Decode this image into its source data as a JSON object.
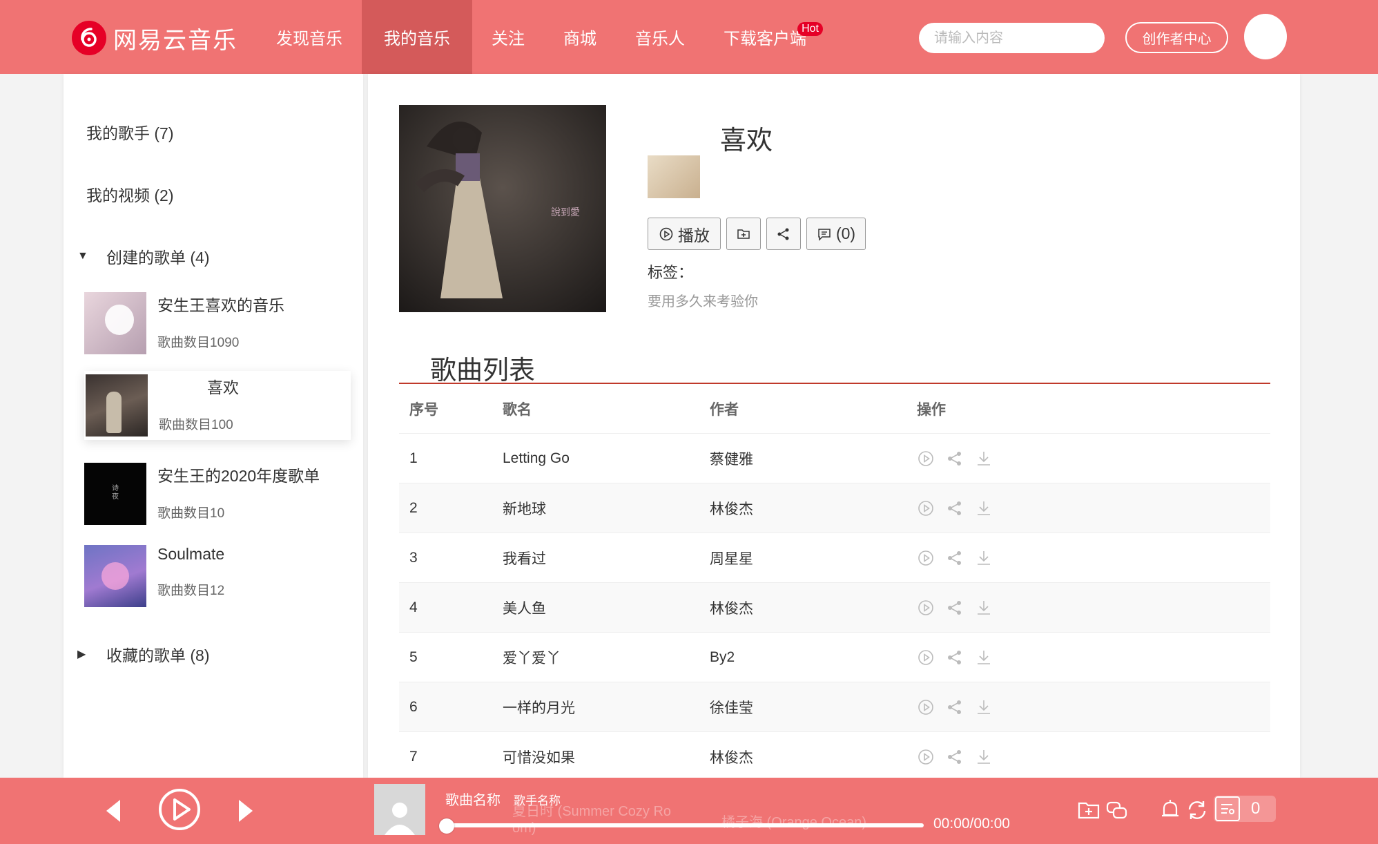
{
  "brand": {
    "logo_glyph": "◎",
    "name": "网易云音乐",
    "accent": "#f07373",
    "active_nav_bg": "#d45a5a",
    "logo_red": "#e60026"
  },
  "nav": [
    {
      "label": "发现音乐"
    },
    {
      "label": "我的音乐",
      "active": true
    },
    {
      "label": "关注"
    },
    {
      "label": "商城"
    },
    {
      "label": "音乐人"
    },
    {
      "label": "下载客户端",
      "badge": "Hot"
    }
  ],
  "search": {
    "placeholder": "请输入内容",
    "icon": "search-icon"
  },
  "header": {
    "creator_center": "创作者中心"
  },
  "sidebar": {
    "my_singers": "我的歌手 (7)",
    "my_videos": "我的视频 (2)",
    "created_group": {
      "label": "创建的歌单 (4)",
      "expanded": true
    },
    "playlists": [
      {
        "name": "安生王喜欢的音乐",
        "count": "歌曲数目1090"
      },
      {
        "name": "喜欢",
        "count": "歌曲数目100",
        "active": true
      },
      {
        "name": "安生王的2020年度歌单",
        "count": "歌曲数目10"
      },
      {
        "name": "Soulmate",
        "count": "歌曲数目12"
      }
    ],
    "collected_group": {
      "label": "收藏的歌单 (8)",
      "expanded": false
    }
  },
  "detail": {
    "title": "喜欢",
    "buttons": {
      "play": "播放",
      "comments": "(0)"
    },
    "tags_label": "标签：",
    "description": "要用多久来考验你"
  },
  "song_list": {
    "title": "歌曲列表",
    "columns": [
      "序号",
      "歌名",
      "作者",
      "操作"
    ],
    "rows": [
      {
        "no": "1",
        "name": "Letting Go",
        "artist": "蔡健雅"
      },
      {
        "no": "2",
        "name": "新地球",
        "artist": "林俊杰"
      },
      {
        "no": "3",
        "name": "我看过",
        "artist": "周星星"
      },
      {
        "no": "4",
        "name": "美人鱼",
        "artist": "林俊杰"
      },
      {
        "no": "5",
        "name": "爱丫爱丫",
        "artist": "By2"
      },
      {
        "no": "6",
        "name": "一样的月光",
        "artist": "徐佳莹"
      },
      {
        "no": "7",
        "name": "可惜没如果",
        "artist": "林俊杰"
      }
    ]
  },
  "player": {
    "song_name": "歌曲名称",
    "artist_name": "歌手名称",
    "ghost_song": "夏日时 (Summer Cozy Ro",
    "ghost_song_2": "om)",
    "ghost_artist": "橘子海 (Orange Ocean)",
    "time": "00:00/00:00",
    "progress": 0,
    "queue_count": "0"
  }
}
